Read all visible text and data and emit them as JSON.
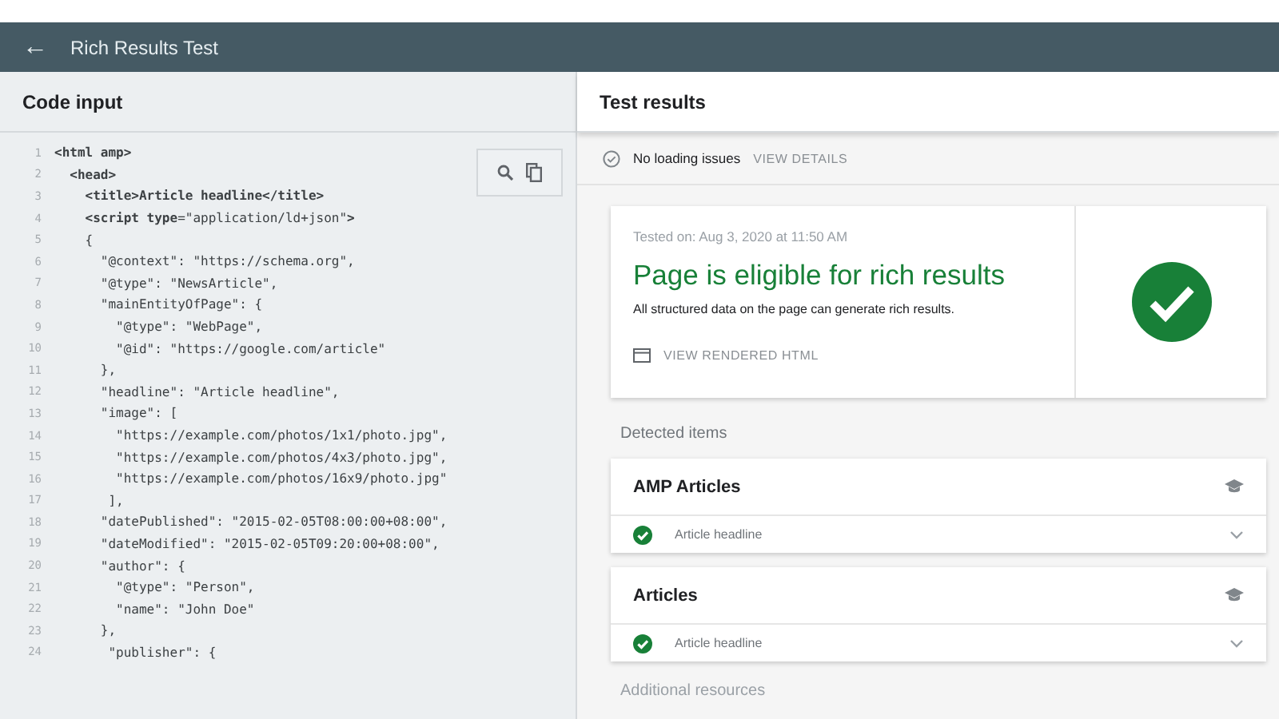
{
  "app_bar": {
    "back_icon": "←",
    "title": "Rich Results Test"
  },
  "code_panel": {
    "title": "Code input",
    "lines": [
      {
        "number": "1",
        "text": "**<html amp>**"
      },
      {
        "number": "2",
        "text": "  **<head>**"
      },
      {
        "number": "3",
        "text": "    **<title>Article headline</title>**"
      },
      {
        "number": "4",
        "text": "    **<script type**=\"application/ld+json\"**>**"
      },
      {
        "number": "5",
        "text": "    {"
      },
      {
        "number": "6",
        "text": "      \"@context\": \"https://schema.org\","
      },
      {
        "number": "7",
        "text": "      \"@type\": \"NewsArticle\","
      },
      {
        "number": "8",
        "text": "      \"mainEntityOfPage\": {"
      },
      {
        "number": "9",
        "text": "        \"@type\": \"WebPage\","
      },
      {
        "number": "10",
        "text": "        \"@id\": \"https://google.com/article\""
      },
      {
        "number": "11",
        "text": "      },"
      },
      {
        "number": "12",
        "text": "      \"headline\": \"Article headline\","
      },
      {
        "number": "13",
        "text": "      \"image\": ["
      },
      {
        "number": "14",
        "text": "        \"https://example.com/photos/1x1/photo.jpg\","
      },
      {
        "number": "15",
        "text": "        \"https://example.com/photos/4x3/photo.jpg\","
      },
      {
        "number": "16",
        "text": "        \"https://example.com/photos/16x9/photo.jpg\""
      },
      {
        "number": "17",
        "text": "       ],"
      },
      {
        "number": "18",
        "text": "      \"datePublished\": \"2015-02-05T08:00:00+08:00\","
      },
      {
        "number": "19",
        "text": "      \"dateModified\": \"2015-02-05T09:20:00+08:00\","
      },
      {
        "number": "20",
        "text": "      \"author\": {"
      },
      {
        "number": "21",
        "text": "        \"@type\": \"Person\","
      },
      {
        "number": "22",
        "text": "        \"name\": \"John Doe\""
      },
      {
        "number": "23",
        "text": "      },"
      },
      {
        "number": "24",
        "text": "       \"publisher\": {"
      }
    ]
  },
  "results_panel": {
    "title": "Test results",
    "loading": {
      "label": "No loading issues",
      "action": "VIEW DETAILS"
    },
    "summary": {
      "tested_on": "Tested on: Aug 3, 2020 at 11:50 AM",
      "headline": "Page is eligible for rich results",
      "description": "All structured data on the page can generate rich results.",
      "action": "VIEW RENDERED HTML"
    },
    "detected_label": "Detected items",
    "items": [
      {
        "title": "AMP Articles",
        "entries": [
          {
            "label": "Article headline",
            "valid": true
          }
        ]
      },
      {
        "title": "Articles",
        "entries": [
          {
            "label": "Article headline",
            "valid": true
          }
        ]
      }
    ],
    "additional_label": "Additional resources"
  }
}
